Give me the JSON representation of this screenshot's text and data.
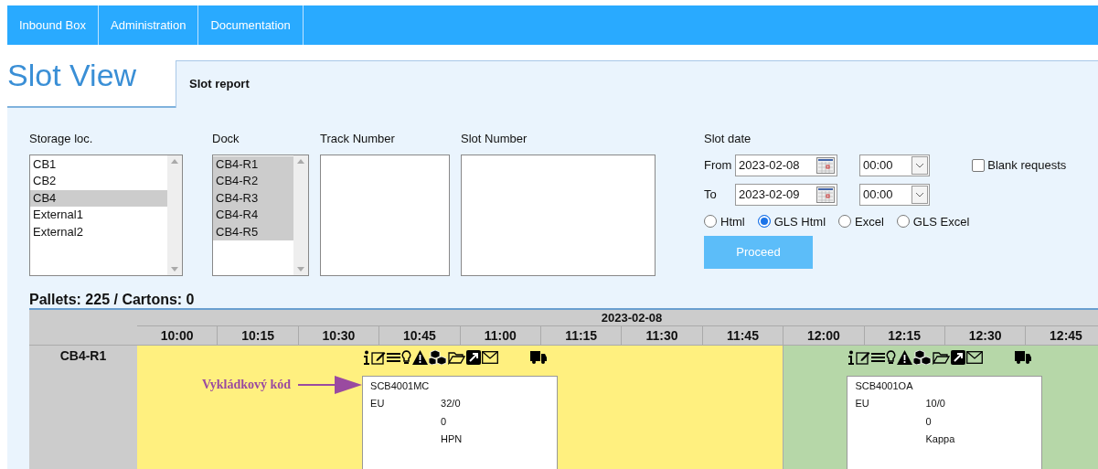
{
  "nav": {
    "items": [
      {
        "label": "Inbound Box"
      },
      {
        "label": "Administration"
      },
      {
        "label": "Documentation"
      }
    ]
  },
  "header": {
    "title": "Slot View",
    "tab": {
      "label": "Slot report",
      "selected": true
    }
  },
  "filters": {
    "storage": {
      "label": "Storage loc.",
      "options": [
        {
          "label": "CB1",
          "selected": false
        },
        {
          "label": "CB2",
          "selected": false
        },
        {
          "label": "CB4",
          "selected": true
        },
        {
          "label": "External1",
          "selected": false
        },
        {
          "label": "External2",
          "selected": false
        }
      ]
    },
    "dock": {
      "label": "Dock",
      "options": [
        {
          "label": "CB4-R1",
          "selected": true
        },
        {
          "label": "CB4-R2",
          "selected": true
        },
        {
          "label": "CB4-R3",
          "selected": true
        },
        {
          "label": "CB4-R4",
          "selected": true
        },
        {
          "label": "CB4-R5",
          "selected": true
        }
      ]
    },
    "track": {
      "label": "Track Number"
    },
    "slot": {
      "label": "Slot Number"
    },
    "slot_date": {
      "label": "Slot date",
      "from": {
        "label": "From",
        "date": "2023-02-08",
        "time": "00:00"
      },
      "to": {
        "label": "To",
        "date": "2023-02-09",
        "time": "00:00"
      }
    },
    "blank_requests": {
      "label": "Blank requests",
      "checked": false
    },
    "formats": [
      {
        "label": "Html",
        "selected": false
      },
      {
        "label": "GLS Html",
        "selected": true
      },
      {
        "label": "Excel",
        "selected": false
      },
      {
        "label": "GLS Excel",
        "selected": false
      }
    ],
    "proceed": {
      "label": "Proceed"
    }
  },
  "summary": "Pallets: 225 / Cartons: 0",
  "schedule": {
    "date": "2023-02-08",
    "times": [
      "10:00",
      "10:15",
      "10:30",
      "10:45",
      "11:00",
      "11:15",
      "11:30",
      "11:45",
      "12:00",
      "12:15",
      "12:30",
      "12:45"
    ],
    "rows": [
      {
        "label": "CB4-R1",
        "slots": [
          {
            "color": "#fff07f",
            "annotation": "Vykládkový kód",
            "card": {
              "code": "SCB4001MC",
              "type": "EU",
              "quantity": "32/0",
              "count": "0",
              "company": "HPN"
            }
          },
          {
            "color": "#b6d7a8",
            "card": {
              "code": "SCB4001OA",
              "type": "EU",
              "quantity": "10/0",
              "count": "0",
              "company": "Kappa"
            }
          }
        ]
      }
    ]
  }
}
